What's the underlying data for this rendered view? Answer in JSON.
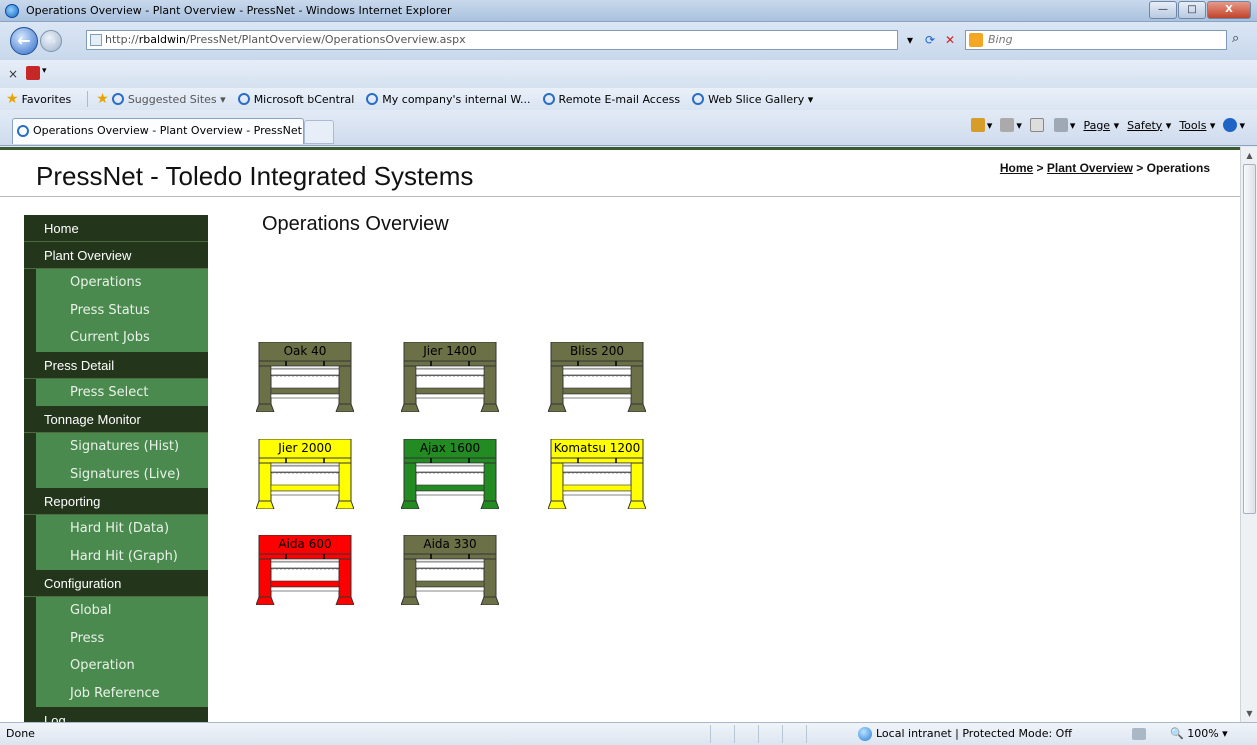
{
  "window": {
    "title": "Operations Overview - Plant Overview - PressNet - Windows Internet Explorer",
    "minimize": "—",
    "maximize": "□",
    "close": "X"
  },
  "address": {
    "url_prefix": "http://",
    "url_host": "rbaldwin",
    "url_path": "/PressNet/PlantOverview/OperationsOverview.aspx",
    "search_placeholder": "Bing"
  },
  "favorites": {
    "label": "Favorites",
    "items": [
      {
        "label": "Suggested Sites ▾"
      },
      {
        "label": "Microsoft bCentral"
      },
      {
        "label": "My company's internal W..."
      },
      {
        "label": "Remote E-mail Access"
      },
      {
        "label": "Web Slice Gallery ▾"
      }
    ]
  },
  "tab": {
    "label": "Operations Overview - Plant Overview - PressNet"
  },
  "commands": {
    "page": "Page",
    "safety": "Safety",
    "tools": "Tools"
  },
  "site": {
    "title": "PressNet - Toledo Integrated Systems",
    "breadcrumb": {
      "home": "Home",
      "sep": " > ",
      "plant": "Plant Overview",
      "current": "Operations"
    }
  },
  "nav": {
    "home": "Home",
    "plant_overview": "Plant Overview",
    "operations": "Operations",
    "press_status": "Press Status",
    "current_jobs": "Current Jobs",
    "press_detail": "Press Detail",
    "press_select": "Press Select",
    "tonnage_monitor": "Tonnage Monitor",
    "signatures_hist": "Signatures (Hist)",
    "signatures_live": "Signatures (Live)",
    "reporting": "Reporting",
    "hard_hit_data": "Hard Hit (Data)",
    "hard_hit_graph": "Hard Hit (Graph)",
    "configuration": "Configuration",
    "global": "Global",
    "press": "Press",
    "operation": "Operation",
    "job_reference": "Job Reference",
    "log": "Log"
  },
  "content": {
    "title": "Operations Overview"
  },
  "presses": [
    {
      "name": "Oak 40",
      "color": "#6b7047"
    },
    {
      "name": "Jier 1400",
      "color": "#6b7047"
    },
    {
      "name": "Bliss 200",
      "color": "#6b7047"
    },
    {
      "name": "Jier 2000",
      "color": "#ffff00"
    },
    {
      "name": "Ajax 1600",
      "color": "#228b22"
    },
    {
      "name": "Komatsu 1200",
      "color": "#ffff00"
    },
    {
      "name": "Aida 600",
      "color": "#ff0000"
    },
    {
      "name": "Aida 330",
      "color": "#6b7047"
    }
  ],
  "status": {
    "done": "Done",
    "zone": "Local intranet | Protected Mode: Off",
    "zoom": "100%"
  }
}
